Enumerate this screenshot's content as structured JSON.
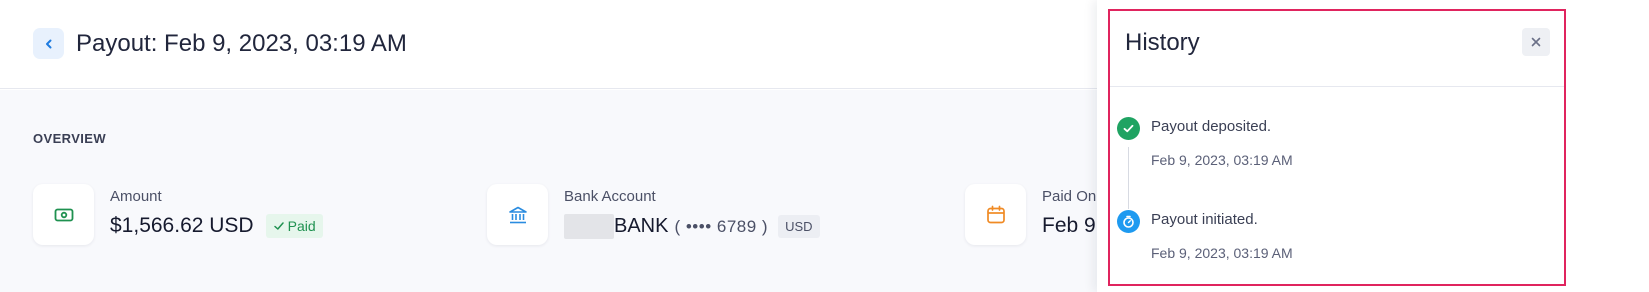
{
  "header": {
    "title": "Payout: Feb 9, 2023, 03:19 AM",
    "back_icon": "chevron-left-icon"
  },
  "overview": {
    "section_label": "OVERVIEW",
    "cards": [
      {
        "label": "Amount",
        "value": "$1,566.62 USD",
        "badge": "Paid",
        "badge_icon": "check-icon",
        "icon": "cash-icon",
        "icon_color": "#1f9150"
      },
      {
        "label": "Bank Account",
        "bank_name": "BANK",
        "account_mask": "( •••• 6789 )",
        "currency": "USD",
        "icon": "bank-icon",
        "icon_color": "#2a8ce0"
      },
      {
        "label": "Paid On",
        "value": "Feb 9,",
        "icon": "calendar-icon",
        "icon_color": "#f08a24"
      }
    ]
  },
  "history": {
    "title": "History",
    "close_icon": "close-icon",
    "events": [
      {
        "text": "Payout deposited.",
        "time": "Feb 9, 2023, 03:19 AM",
        "icon": "check-circle-icon",
        "color": "#1fa362"
      },
      {
        "text": "Payout initiated.",
        "time": "Feb 9, 2023, 03:19 AM",
        "icon": "stopwatch-icon",
        "color": "#1e9af0"
      }
    ],
    "highlight_color": "#e0245e"
  }
}
